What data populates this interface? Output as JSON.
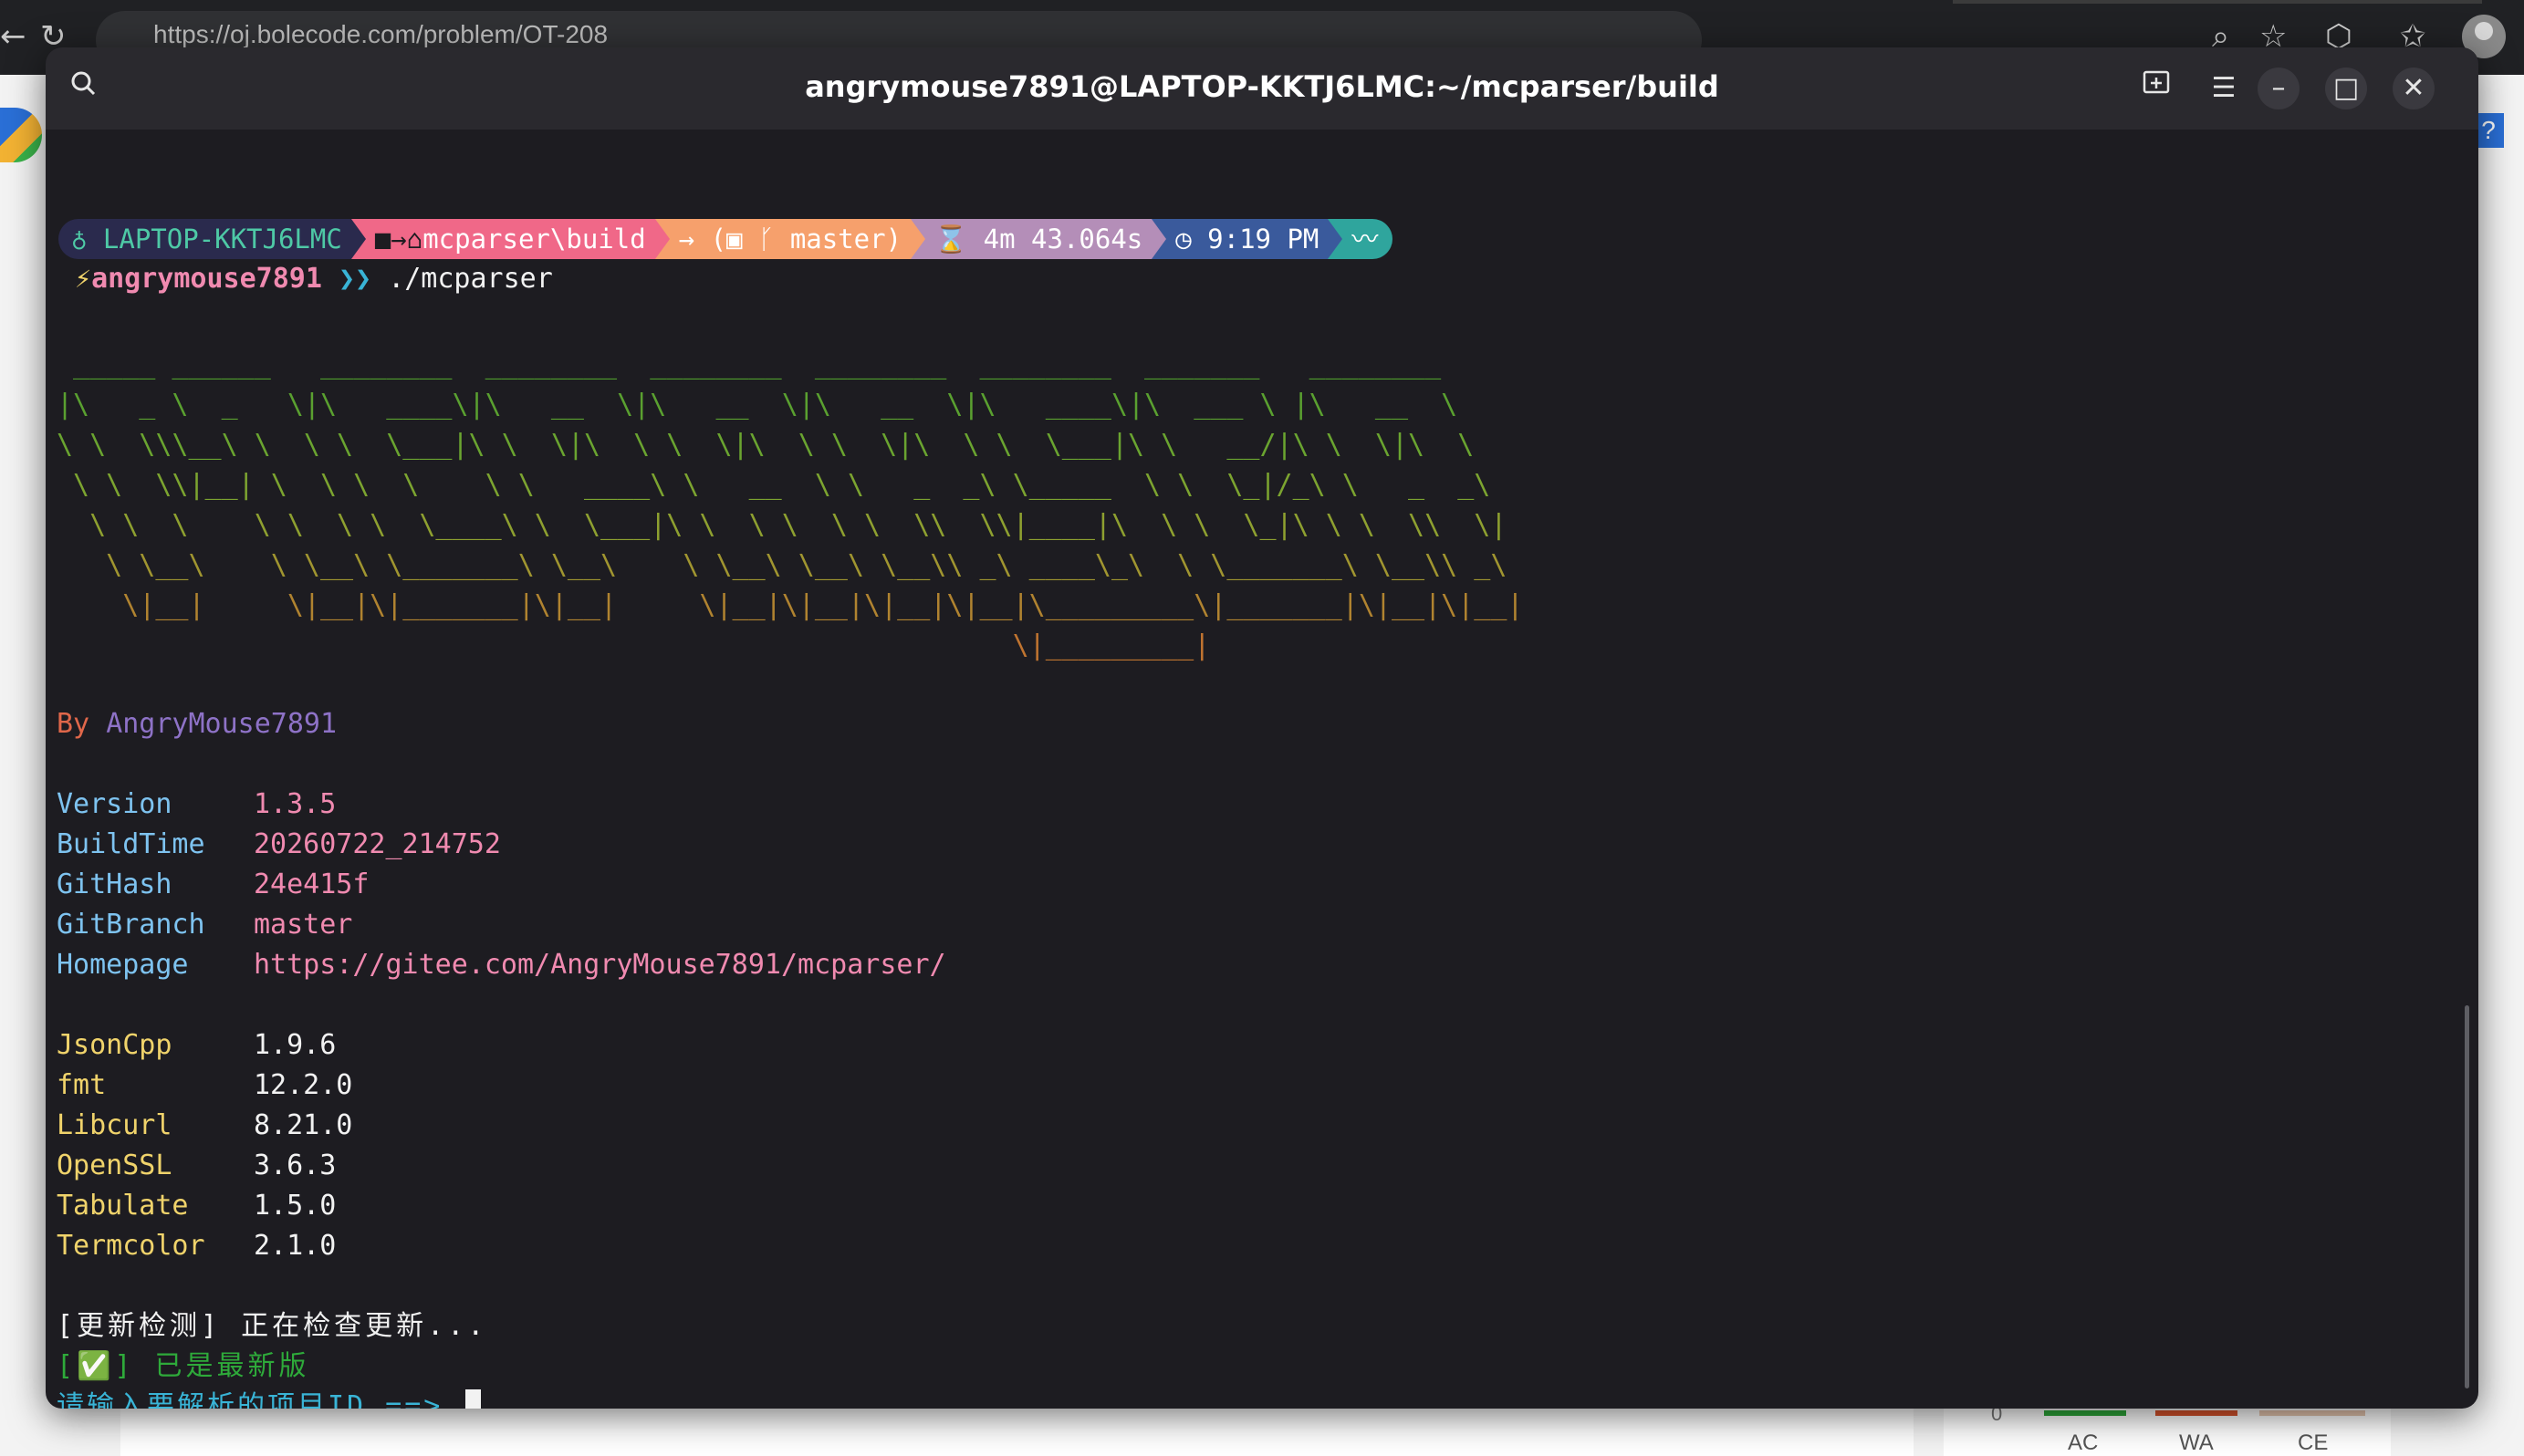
{
  "browser": {
    "url": "https://oj.bolecode.com/problem/OT-208",
    "help_label": "?",
    "mini_chart": {
      "zero": "0",
      "labels": [
        "AC",
        "WA",
        "CE"
      ]
    }
  },
  "window": {
    "title": "angrymouse7891@LAPTOP-KKTJ6LMC:~/mcparser/build",
    "buttons": {
      "minimize": "–",
      "maximize": "□",
      "close": "✕"
    }
  },
  "prompt": {
    "host": "LAPTOP-KKTJ6LMC",
    "path": "mcparser\\build",
    "branch": "master",
    "duration": "4m 43.064s",
    "clock": "9:19 PM",
    "user": "angrymouse7891",
    "command": "./mcparser"
  },
  "ascii_art": [
    " _____ ______   ________  ________  ________  ________  ________  _______   ________",
    "|\\   _ \\  _   \\|\\   ____\\|\\   __  \\|\\   __  \\|\\   __  \\|\\   ____\\|\\  ___ \\ |\\   __  \\",
    "\\ \\  \\\\\\__\\ \\  \\ \\  \\___|\\ \\  \\|\\  \\ \\  \\|\\  \\ \\  \\|\\  \\ \\  \\___|\\ \\   __/|\\ \\  \\|\\  \\",
    " \\ \\  \\\\|__| \\  \\ \\  \\    \\ \\   ____\\ \\   __  \\ \\   _  _\\ \\_____  \\ \\  \\_|/_\\ \\   _  _\\",
    "  \\ \\  \\    \\ \\  \\ \\  \\____\\ \\  \\___|\\ \\  \\ \\  \\ \\  \\\\  \\\\|____|\\  \\ \\  \\_|\\ \\ \\  \\\\  \\|",
    "   \\ \\__\\    \\ \\__\\ \\_______\\ \\__\\    \\ \\__\\ \\__\\ \\__\\\\ _\\ ____\\_\\  \\ \\_______\\ \\__\\\\ _\\",
    "    \\|__|     \\|__|\\|_______|\\|__|     \\|__|\\|__|\\|__|\\|__|\\_________\\|_______|\\|__|\\|__|",
    "                                                          \\|_________|"
  ],
  "by": {
    "prefix": "By ",
    "author": "AngryMouse7891"
  },
  "info": [
    {
      "key": "Version",
      "value": "1.3.5"
    },
    {
      "key": "BuildTime",
      "value": "20260722_214752"
    },
    {
      "key": "GitHash",
      "value": "24e415f"
    },
    {
      "key": "GitBranch",
      "value": "master"
    },
    {
      "key": "Homepage",
      "value": "https://gitee.com/AngryMouse7891/mcparser/"
    }
  ],
  "deps": [
    {
      "key": "JsonCpp",
      "value": "1.9.6"
    },
    {
      "key": "fmt",
      "value": "12.2.0"
    },
    {
      "key": "Libcurl",
      "value": "8.21.0"
    },
    {
      "key": "OpenSSL",
      "value": "3.6.3"
    },
    {
      "key": "Tabulate",
      "value": "1.5.0"
    },
    {
      "key": "Termcolor",
      "value": "2.1.0"
    }
  ],
  "update": {
    "checking": "[更新检测] 正在检查更新...",
    "latest": "[✅] 已是最新版",
    "input_prompt": "请输入要解析的项目ID ==> "
  }
}
